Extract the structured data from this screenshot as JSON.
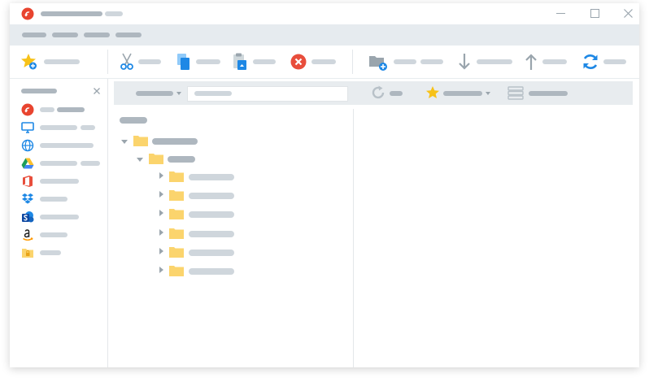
{
  "window": {
    "title": ""
  },
  "titlebar": {
    "buttons": [
      "minimize-icon",
      "maximize-icon",
      "close-icon"
    ]
  },
  "menu": {
    "items": [
      "",
      "",
      "",
      ""
    ]
  },
  "toolbar": {
    "groups": [
      {
        "items": [
          {
            "icon": "star-add-icon",
            "label": ""
          }
        ]
      },
      {
        "items": [
          {
            "icon": "scissors-icon",
            "label": ""
          },
          {
            "icon": "copy-icon",
            "label": ""
          },
          {
            "icon": "paste-icon",
            "label": ""
          },
          {
            "icon": "delete-icon",
            "label": ""
          }
        ]
      },
      {
        "items": [
          {
            "icon": "new-folder-icon",
            "label": ""
          },
          {
            "icon": "download-icon",
            "label": ""
          },
          {
            "icon": "upload-icon",
            "label": ""
          },
          {
            "icon": "refresh-icon",
            "label": ""
          }
        ]
      }
    ]
  },
  "sidebar": {
    "title": "",
    "close_icon": "close-icon",
    "items": [
      {
        "icon": "app-logo-icon",
        "label": ""
      },
      {
        "icon": "computer-icon",
        "label": ""
      },
      {
        "icon": "globe-icon",
        "label": ""
      },
      {
        "icon": "google-drive-icon",
        "label": ""
      },
      {
        "icon": "office-icon",
        "label": ""
      },
      {
        "icon": "dropbox-icon",
        "label": ""
      },
      {
        "icon": "sharepoint-icon",
        "label": ""
      },
      {
        "icon": "amazon-icon",
        "label": ""
      },
      {
        "icon": "locked-folder-icon",
        "label": ""
      }
    ]
  },
  "pathbar": {
    "location_dropdown": "",
    "path_value": "",
    "refresh_label": "",
    "favorites_label": "",
    "view_label": ""
  },
  "tree": {
    "root": "",
    "level1": {
      "label": "",
      "expanded": true
    },
    "level2": {
      "label": "",
      "expanded": true
    },
    "children": [
      "",
      "",
      "",
      "",
      "",
      ""
    ]
  },
  "colors": {
    "accent": "#1e88e5",
    "folder": "#fbd46d",
    "placeholder": "#cfd6dc",
    "menubar": "#e6ebef",
    "logo": "#e8442f"
  }
}
